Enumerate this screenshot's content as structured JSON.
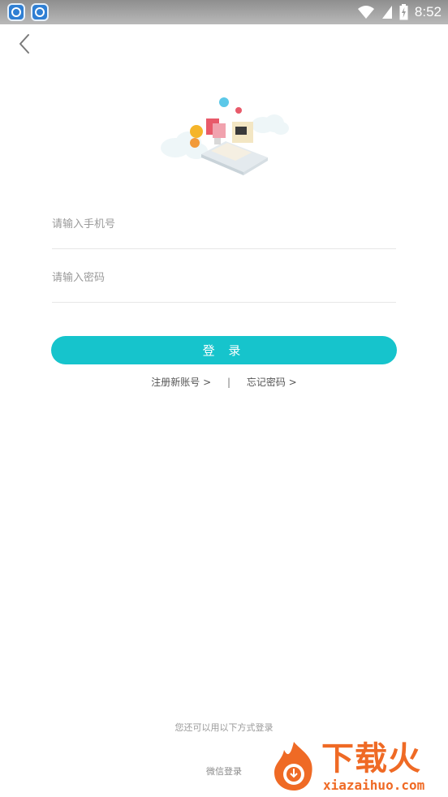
{
  "status_bar": {
    "time": "8:52",
    "notification_icons": [
      "app-notification-icon",
      "app-notification-icon"
    ],
    "indicators": [
      "wifi-icon",
      "signal-icon",
      "battery-charging-icon"
    ]
  },
  "nav": {
    "back_icon": "chevron-left-icon"
  },
  "form": {
    "phone_placeholder": "请输入手机号",
    "phone_value": "",
    "password_placeholder": "请输入密码",
    "password_value": "",
    "login_label": "登 录"
  },
  "links": {
    "register": "注册新账号 >",
    "separator": "|",
    "forgot": "忘记密码 >"
  },
  "footer": {
    "other_methods": "您还可以用以下方式登录",
    "wechat_login": "微信登录"
  },
  "watermark": {
    "title": "下载火",
    "url": "xiazaihuo.com"
  },
  "colors": {
    "accent": "#16c4cc",
    "watermark": "#ef6a25",
    "placeholder": "#9a9a9a"
  }
}
